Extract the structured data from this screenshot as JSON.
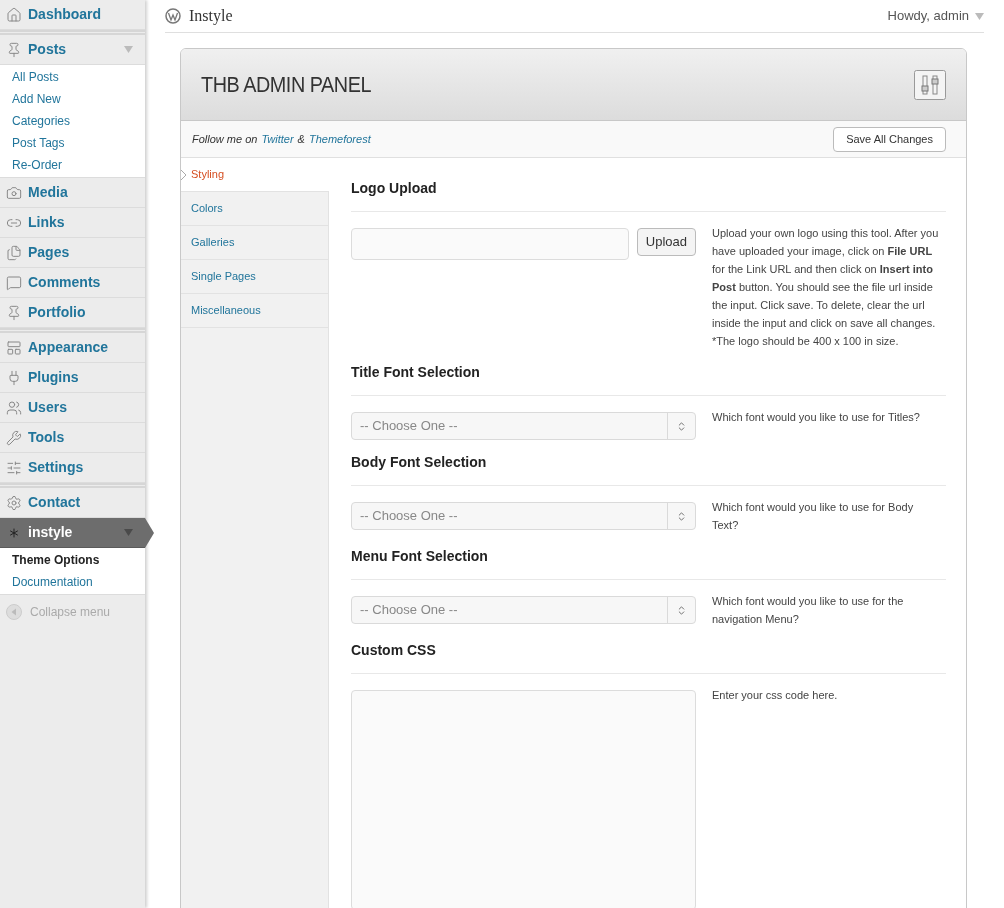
{
  "sidebar": {
    "groups": [
      [
        {
          "label": "Dashboard",
          "current": false,
          "open": false
        }
      ],
      [
        {
          "label": "Posts",
          "current": false,
          "open": true,
          "submenu": [
            {
              "label": "All Posts",
              "selected": false
            },
            {
              "label": "Add New",
              "selected": false
            },
            {
              "label": "Categories",
              "selected": false
            },
            {
              "label": "Post Tags",
              "selected": false
            },
            {
              "label": "Re-Order",
              "selected": false
            }
          ]
        },
        {
          "label": "Media",
          "current": false,
          "open": false
        },
        {
          "label": "Links",
          "current": false,
          "open": false
        },
        {
          "label": "Pages",
          "current": false,
          "open": false
        },
        {
          "label": "Comments",
          "current": false,
          "open": false
        },
        {
          "label": "Portfolio",
          "current": false,
          "open": false
        }
      ],
      [
        {
          "label": "Appearance",
          "current": false,
          "open": false
        },
        {
          "label": "Plugins",
          "current": false,
          "open": false
        },
        {
          "label": "Users",
          "current": false,
          "open": false
        },
        {
          "label": "Tools",
          "current": false,
          "open": false
        },
        {
          "label": "Settings",
          "current": false,
          "open": false
        }
      ],
      [
        {
          "label": "Contact",
          "current": false,
          "open": false
        },
        {
          "label": "instyle",
          "current": true,
          "open": true,
          "submenu": [
            {
              "label": "Theme Options",
              "selected": true
            },
            {
              "label": "Documentation",
              "selected": false
            }
          ]
        }
      ]
    ],
    "collapse": "Collapse menu"
  },
  "topbar": {
    "site": "Instyle",
    "greeting": "Howdy, admin"
  },
  "panel": {
    "title": "THB ADMIN PANEL",
    "follow": {
      "text": "Follow me on",
      "link1": "Twitter",
      "amp": "&",
      "link2": "Themeforest"
    },
    "save": "Save All Changes",
    "tabs": [
      {
        "label": "Styling",
        "selected": true
      },
      {
        "label": "Colors",
        "selected": false
      },
      {
        "label": "Galleries",
        "selected": false
      },
      {
        "label": "Single Pages",
        "selected": false
      },
      {
        "label": "Miscellaneous",
        "selected": false
      }
    ],
    "sections": [
      {
        "kind": "upload",
        "heading": "Logo Upload",
        "button": "Upload",
        "help": "Upload your own logo using this tool. After you have uploaded your image, click on **File URL** for the Link URL and then click on **Insert into Post** button. You should see the file url inside the input. Click save. To delete, clear the url inside the input and click on save all changes. *The logo should be 400 x 100 in size."
      },
      {
        "kind": "select",
        "heading": "Title Font Selection",
        "value": "-- Choose One --",
        "help": "Which font would you like to use for Titles?"
      },
      {
        "kind": "select",
        "heading": "Body Font Selection",
        "value": "-- Choose One --",
        "help": "Which font would you like to use for Body Text?"
      },
      {
        "kind": "select",
        "heading": "Menu Font Selection",
        "value": "-- Choose One --",
        "help": "Which font would you like to use for the navigation Menu?"
      },
      {
        "kind": "textarea",
        "heading": "Custom CSS",
        "help": "Enter your css code here."
      }
    ]
  }
}
